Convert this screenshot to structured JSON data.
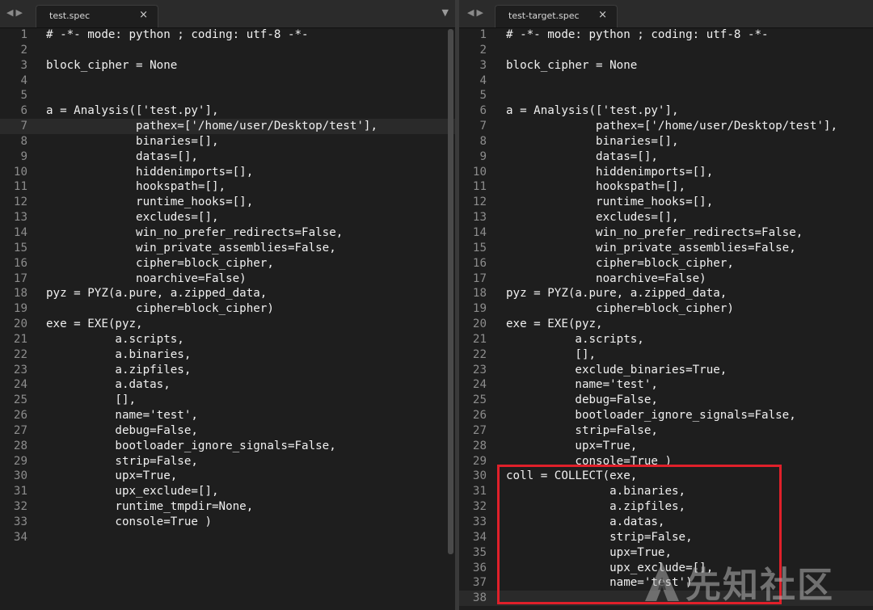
{
  "left_pane": {
    "tab_title": "test.spec",
    "close_glyph": "×",
    "nav_back_glyph": "◀",
    "nav_forward_glyph": "▶",
    "dropdown_glyph": "▼",
    "highlighted_line": 7,
    "lines": [
      {
        "n": "1",
        "t": "# -*- mode: python ; coding: utf-8 -*-"
      },
      {
        "n": "2",
        "t": ""
      },
      {
        "n": "3",
        "t": "block_cipher = None"
      },
      {
        "n": "4",
        "t": ""
      },
      {
        "n": "5",
        "t": ""
      },
      {
        "n": "6",
        "t": "a = Analysis(['test.py'],"
      },
      {
        "n": "7",
        "t": "             pathex=['/home/user/Desktop/test'],"
      },
      {
        "n": "8",
        "t": "             binaries=[],"
      },
      {
        "n": "9",
        "t": "             datas=[],"
      },
      {
        "n": "10",
        "t": "             hiddenimports=[],"
      },
      {
        "n": "11",
        "t": "             hookspath=[],"
      },
      {
        "n": "12",
        "t": "             runtime_hooks=[],"
      },
      {
        "n": "13",
        "t": "             excludes=[],"
      },
      {
        "n": "14",
        "t": "             win_no_prefer_redirects=False,"
      },
      {
        "n": "15",
        "t": "             win_private_assemblies=False,"
      },
      {
        "n": "16",
        "t": "             cipher=block_cipher,"
      },
      {
        "n": "17",
        "t": "             noarchive=False)"
      },
      {
        "n": "18",
        "t": "pyz = PYZ(a.pure, a.zipped_data,"
      },
      {
        "n": "19",
        "t": "             cipher=block_cipher)"
      },
      {
        "n": "20",
        "t": "exe = EXE(pyz,"
      },
      {
        "n": "21",
        "t": "          a.scripts,"
      },
      {
        "n": "22",
        "t": "          a.binaries,"
      },
      {
        "n": "23",
        "t": "          a.zipfiles,"
      },
      {
        "n": "24",
        "t": "          a.datas,"
      },
      {
        "n": "25",
        "t": "          [],"
      },
      {
        "n": "26",
        "t": "          name='test',"
      },
      {
        "n": "27",
        "t": "          debug=False,"
      },
      {
        "n": "28",
        "t": "          bootloader_ignore_signals=False,"
      },
      {
        "n": "29",
        "t": "          strip=False,"
      },
      {
        "n": "30",
        "t": "          upx=True,"
      },
      {
        "n": "31",
        "t": "          upx_exclude=[],"
      },
      {
        "n": "32",
        "t": "          runtime_tmpdir=None,"
      },
      {
        "n": "33",
        "t": "          console=True )"
      },
      {
        "n": "34",
        "t": ""
      }
    ]
  },
  "right_pane": {
    "tab_title": "test-target.spec",
    "close_glyph": "×",
    "nav_back_glyph": "◀",
    "nav_forward_glyph": "▶",
    "highlighted_line": 38,
    "lines": [
      {
        "n": "1",
        "t": "# -*- mode: python ; coding: utf-8 -*-"
      },
      {
        "n": "2",
        "t": ""
      },
      {
        "n": "3",
        "t": "block_cipher = None"
      },
      {
        "n": "4",
        "t": ""
      },
      {
        "n": "5",
        "t": ""
      },
      {
        "n": "6",
        "t": "a = Analysis(['test.py'],"
      },
      {
        "n": "7",
        "t": "             pathex=['/home/user/Desktop/test'],"
      },
      {
        "n": "8",
        "t": "             binaries=[],"
      },
      {
        "n": "9",
        "t": "             datas=[],"
      },
      {
        "n": "10",
        "t": "             hiddenimports=[],"
      },
      {
        "n": "11",
        "t": "             hookspath=[],"
      },
      {
        "n": "12",
        "t": "             runtime_hooks=[],"
      },
      {
        "n": "13",
        "t": "             excludes=[],"
      },
      {
        "n": "14",
        "t": "             win_no_prefer_redirects=False,"
      },
      {
        "n": "15",
        "t": "             win_private_assemblies=False,"
      },
      {
        "n": "16",
        "t": "             cipher=block_cipher,"
      },
      {
        "n": "17",
        "t": "             noarchive=False)"
      },
      {
        "n": "18",
        "t": "pyz = PYZ(a.pure, a.zipped_data,"
      },
      {
        "n": "19",
        "t": "             cipher=block_cipher)"
      },
      {
        "n": "20",
        "t": "exe = EXE(pyz,"
      },
      {
        "n": "21",
        "t": "          a.scripts,"
      },
      {
        "n": "22",
        "t": "          [],"
      },
      {
        "n": "23",
        "t": "          exclude_binaries=True,"
      },
      {
        "n": "24",
        "t": "          name='test',"
      },
      {
        "n": "25",
        "t": "          debug=False,"
      },
      {
        "n": "26",
        "t": "          bootloader_ignore_signals=False,"
      },
      {
        "n": "27",
        "t": "          strip=False,"
      },
      {
        "n": "28",
        "t": "          upx=True,"
      },
      {
        "n": "29",
        "t": "          console=True )"
      },
      {
        "n": "30",
        "t": "coll = COLLECT(exe,"
      },
      {
        "n": "31",
        "t": "               a.binaries,"
      },
      {
        "n": "32",
        "t": "               a.zipfiles,"
      },
      {
        "n": "33",
        "t": "               a.datas,"
      },
      {
        "n": "34",
        "t": "               strip=False,"
      },
      {
        "n": "35",
        "t": "               upx=True,"
      },
      {
        "n": "36",
        "t": "               upx_exclude=[],"
      },
      {
        "n": "37",
        "t": "               name='test')"
      },
      {
        "n": "38",
        "t": ""
      }
    ]
  },
  "watermark": {
    "text": "先知社区"
  },
  "colors": {
    "background": "#1e1e1e",
    "text": "#f0f0f0",
    "line_number": "#8c8c8c",
    "annotation_box": "#e0202a"
  }
}
